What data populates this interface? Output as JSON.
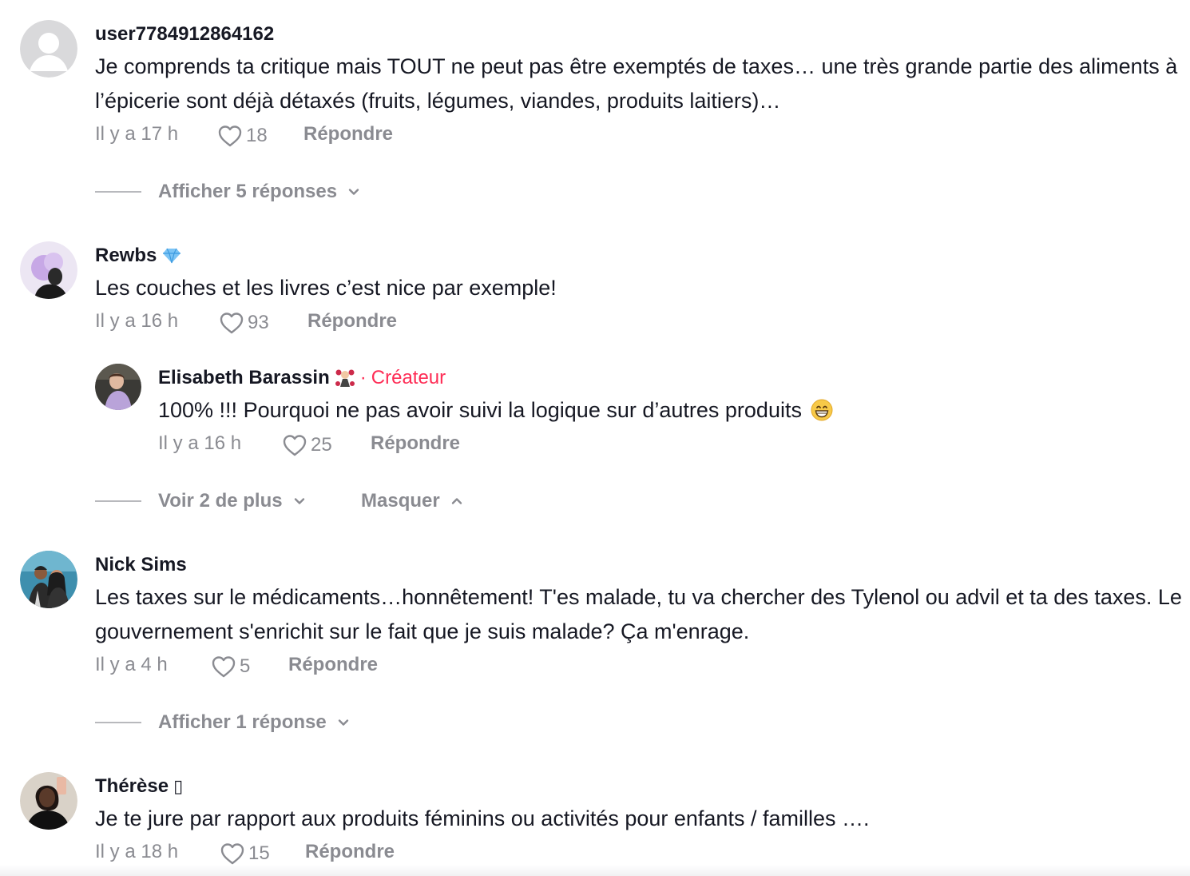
{
  "comments": [
    {
      "username": "user7784912864162",
      "text": "Je comprends ta critique mais TOUT ne peut pas être exemptés de taxes… une très grande partie des aliments à l’épicerie sont déjà détaxés (fruits, légumes, viandes, produits laitiers)…",
      "time": "Il y a 17 h",
      "likes": "18",
      "reply_label": "Répondre",
      "replies_toggle": "Afficher 5 réponses"
    },
    {
      "username": "Rewbs",
      "badge_icon": "gem-icon",
      "text": "Les couches et les livres c’est nice par exemple!",
      "time": "Il y a 16 h",
      "likes": "93",
      "reply_label": "Répondre",
      "reply": {
        "username": "Elisabeth Barassin",
        "separator": "·",
        "creator_label": "Créateur",
        "text": "100% !!! Pourquoi ne pas avoir suivi la logique sur d’autres produits",
        "emoji": "😁",
        "time": "Il y a 16 h",
        "likes": "25",
        "reply_label": "Répondre"
      },
      "more_label": "Voir 2 de plus",
      "hide_label": "Masquer"
    },
    {
      "username": "Nick Sims",
      "text": "Les taxes sur le médicaments…honnêtement! T'es malade, tu va chercher des Tylenol ou advil et ta des taxes. Le gouvernement s'enrichit sur le fait que je suis malade? Ça m'enrage.",
      "time": "Il y a 4 h",
      "likes": "5",
      "reply_label": "Répondre",
      "replies_toggle": "Afficher 1 réponse"
    },
    {
      "username": "Thérèse",
      "username_suffix": "▯",
      "text": "Je te jure par rapport aux produits féminins ou activités pour enfants / familles ….",
      "time": "Il y a 18 h",
      "likes": "15",
      "reply_label": "Répondre"
    }
  ],
  "colors": {
    "text": "#161823",
    "muted": "#8a8b91",
    "creator": "#fe2c55"
  }
}
